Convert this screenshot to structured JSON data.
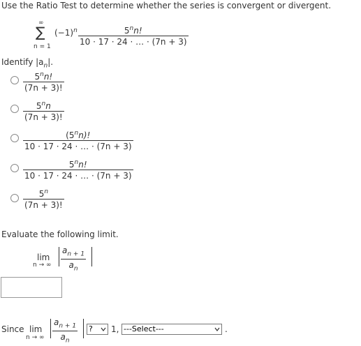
{
  "problem": {
    "instruction": "Use the Ratio Test to determine whether the series is convergent or divergent.",
    "series": {
      "sigma": "∑",
      "upper": "∞",
      "lower": "n = 1",
      "sign_factor": "(−1)",
      "sign_exp": "n",
      "numerator": "5",
      "numerator_exp": "n",
      "numerator_rest": "n!",
      "denominator": "10 · 17 · 24 · … · (7n + 3)"
    }
  },
  "identify": {
    "label": "Identify |a",
    "label_sub": "n",
    "label_end": "|.",
    "options": [
      {
        "num": "5",
        "num_exp": "n",
        "num_rest": "n!",
        "den": "(7n + 3)!"
      },
      {
        "num": "5",
        "num_exp": "n",
        "num_rest": "n",
        "den": "(7n + 3)!"
      },
      {
        "num": "(5",
        "num_exp": "n",
        "num_rest": "n)!",
        "den": "10 · 17 · 24 · … · (7n + 3)"
      },
      {
        "num": "5",
        "num_exp": "n",
        "num_rest": "n!",
        "den": "10 · 17 · 24 · … · (7n + 3)"
      },
      {
        "num": "5",
        "num_exp": "n",
        "num_rest": "",
        "den": "(7n + 3)!"
      }
    ]
  },
  "evaluate": {
    "label": "Evaluate the following limit.",
    "lim": "lim",
    "lim_sub": "n → ∞",
    "ratio_num": "a",
    "ratio_num_sub": "n + 1",
    "ratio_den": "a",
    "ratio_den_sub": "n",
    "answer_value": ""
  },
  "conclusion": {
    "since": "Since",
    "compare_select": "?",
    "one": "1,",
    "verdict_select": "---Select---",
    "period": "."
  }
}
